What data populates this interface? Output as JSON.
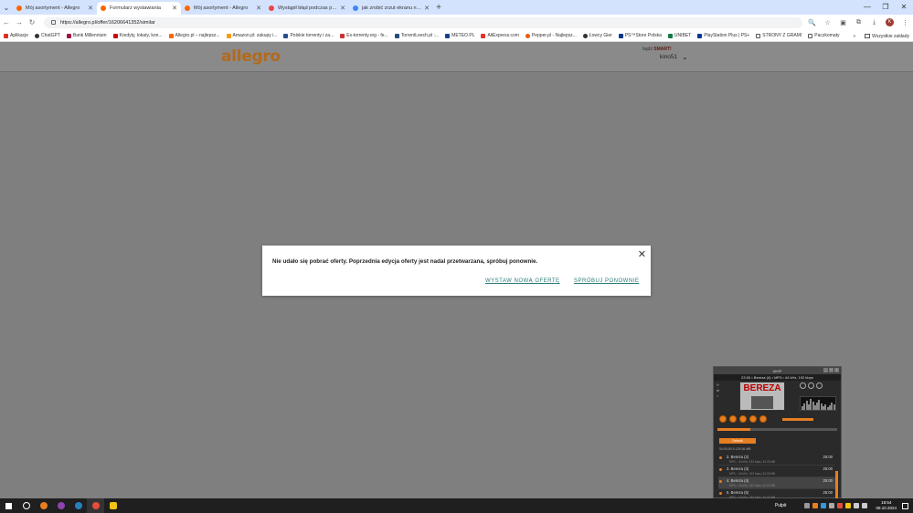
{
  "browser": {
    "tabs": [
      {
        "title": "Mój asortyment - Allegro",
        "active": false
      },
      {
        "title": "Formularz wystawiania",
        "active": true
      },
      {
        "title": "Mój asortyment - Allegro",
        "active": false
      },
      {
        "title": "Wystąpił błąd podczas próby ...",
        "active": false
      },
      {
        "title": "jak zrobić zrzut ekranu na kom...",
        "active": false
      }
    ],
    "url": "https://allegro.pl/offer/16206641352/similar",
    "avatar_letter": "K"
  },
  "bookmarks": {
    "items": [
      "Aplikacje",
      "ChatGPT",
      "Bank Millennium",
      "Kredyty, lokaty, kon...",
      "Allegro.pl – najlepsz...",
      "Amazon.pl: zakupy i...",
      "Polskie torrenty i za...",
      "Ex-torrenty.org - fe...",
      "TorrentLeech.pl :...",
      "METEO.PL",
      "AliExpress.com",
      "Pepper.pl - Najlepsz...",
      "Łowcy Gier",
      "PS™Store Polska",
      "UNIBET",
      "PlayStation Plus | PS+",
      "STRONY Z GRAMI",
      "Paczkomaty"
    ],
    "right_label": "Wszystkie zakłady"
  },
  "site": {
    "logo": "allegro",
    "smart_prefix": "bądź ",
    "smart_label": "SMART!",
    "user": "kino51"
  },
  "dialog": {
    "message": "Nie udało się pobrać oferty. Poprzednia edycja oferty jest nadal przetwarzana, spróbuj ponownie.",
    "btn_new": "WYSTAW NOWĄ OFERTĘ",
    "btn_retry": "SPRÓBUJ PONOWNIE",
    "close": "✕"
  },
  "player": {
    "title": "AIMP",
    "now_playing": "23:00 • Bereza (4) • MP3 • 44 kHz, 192 kbps",
    "cover_text": "BEREZA",
    "playlist_tab": "Default",
    "playlist_info": "00:00:00  5  129.06 MB",
    "items": [
      {
        "name": "2. Bereza (2)",
        "sub": "MP3 :: 44 kHz, 192 kbps, 34.33 MB",
        "duration": "25:00",
        "selected": false
      },
      {
        "name": "3. Bereza (3)",
        "sub": "MP3 :: 44 kHz, 192 kbps, 34.33 MB",
        "duration": "25:00",
        "selected": false
      },
      {
        "name": "4. Bereza (4)",
        "sub": "MP3 :: 44 kHz, 192 kbps, 34.33 MB",
        "duration": "25:00",
        "selected": true
      },
      {
        "name": "5. Bereza (5)",
        "sub": "MP3 :: 44 kHz, 192 kbps, 34.33 MB",
        "duration": "25:00",
        "selected": false
      }
    ]
  },
  "taskbar": {
    "desktop_label": "Pulpit",
    "time": "18:54",
    "date": "08.10.2024"
  }
}
